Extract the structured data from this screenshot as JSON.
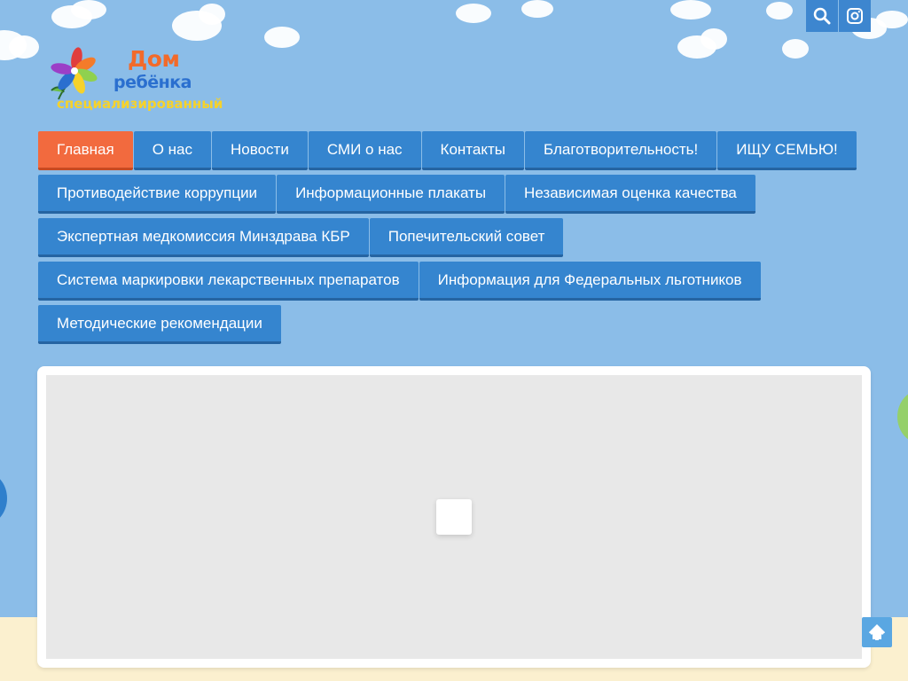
{
  "header": {
    "logo": {
      "line1": "Дом",
      "line2": "ребёнка",
      "line3": "специализированный"
    },
    "icons": [
      {
        "name": "search-icon"
      },
      {
        "name": "instagram-icon"
      }
    ]
  },
  "nav": {
    "rows": [
      [
        {
          "label": "Главная",
          "active": true
        },
        {
          "label": "О нас"
        },
        {
          "label": "Новости"
        },
        {
          "label": "СМИ о нас"
        },
        {
          "label": "Контакты"
        },
        {
          "label": "Благотворительность!"
        },
        {
          "label": "ИЩУ СЕМЬЮ!"
        }
      ],
      [
        {
          "label": "Противодействие коррупции"
        },
        {
          "label": "Информационные плакаты"
        },
        {
          "label": "Независимая оценка качества"
        }
      ],
      [
        {
          "label": "Экспертная медкомиссия Минздрава КБР"
        },
        {
          "label": "Попечительский совет"
        }
      ],
      [
        {
          "label": "Система маркировки лекарственных препаратов"
        },
        {
          "label": "Информация для Федеральных льготников"
        }
      ],
      [
        {
          "label": "Методические рекомендации"
        }
      ]
    ]
  },
  "colors": {
    "sky": "#8bbde8",
    "nav_button": "#3585cf",
    "nav_active": "#f26a3e",
    "panel_bg": "#e8e8e8"
  }
}
